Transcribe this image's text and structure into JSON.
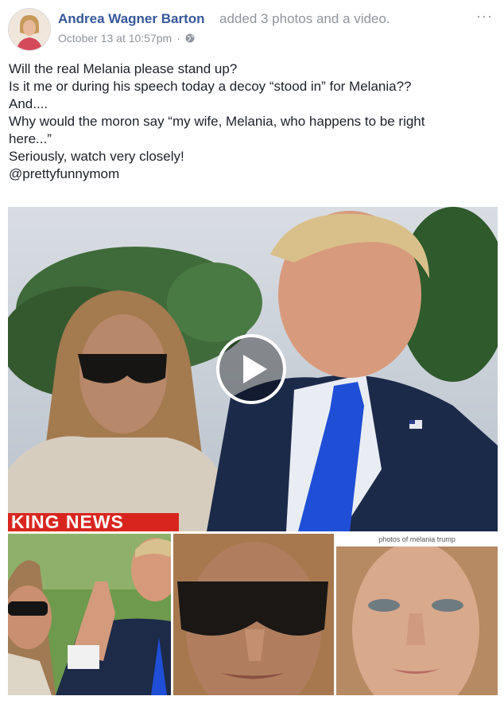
{
  "post": {
    "author": "Andrea Wagner Barton",
    "action": "added 3 photos and a video.",
    "timestamp": "October 13 at 10:57pm",
    "meta_separator": "·",
    "privacy_icon": "globe-icon",
    "more_label": "···"
  },
  "body": {
    "lines": [
      "Will the real Melania please stand up?",
      "Is it me or during his speech today a decoy “stood in” for Melania??",
      "And....",
      "Why would the moron say “my wife, Melania, who happens to be right",
      "here...”",
      "Seriously, watch very closely!",
      "@prettyfunnymom"
    ]
  },
  "media": {
    "banner_text": "KING NEWS",
    "play_icon": "play-icon",
    "thumb3_caption": "photos of melania trump"
  },
  "colors": {
    "author_link": "#365899",
    "muted": "#90949c",
    "text": "#1d2129",
    "tie_blue": "#1f4fd6",
    "banner_red": "#d8261f"
  }
}
